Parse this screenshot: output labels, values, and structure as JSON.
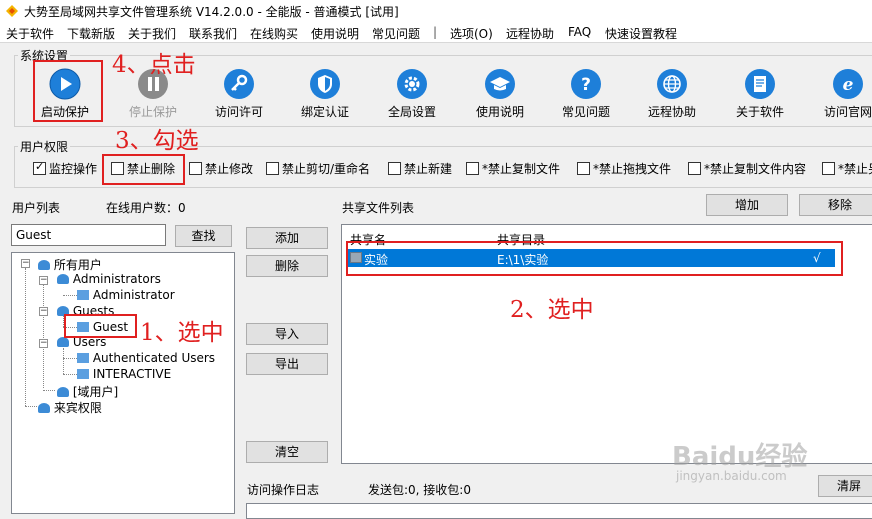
{
  "window": {
    "title": "大势至局域网共享文件管理系统 V14.2.0.0 - 全能版 - 普通模式 [试用]"
  },
  "menu": [
    "关于软件",
    "下载新版",
    "关于我们",
    "联系我们",
    "在线购买",
    "使用说明",
    "常见问题",
    "|",
    "选项(O)",
    "远程协助",
    "FAQ",
    "快速设置教程"
  ],
  "system_settings": {
    "group_label": "系统设置",
    "buttons": [
      {
        "label": "启动保护",
        "icon": "play-icon",
        "color": "#1e7fd9"
      },
      {
        "label": "停止保护",
        "icon": "pause-icon",
        "color": "#8a8a8a"
      },
      {
        "label": "访问许可",
        "icon": "key-icon",
        "color": "#1e7fd9"
      },
      {
        "label": "绑定认证",
        "icon": "shield-icon",
        "color": "#1e7fd9"
      },
      {
        "label": "全局设置",
        "icon": "gear-icon",
        "color": "#1e7fd9"
      },
      {
        "label": "使用说明",
        "icon": "graduation-cap-icon",
        "color": "#1e7fd9"
      },
      {
        "label": "常见问题",
        "icon": "question-icon",
        "color": "#1e7fd9"
      },
      {
        "label": "远程协助",
        "icon": "globe-icon",
        "color": "#1e7fd9"
      },
      {
        "label": "关于软件",
        "icon": "document-icon",
        "color": "#1e7fd9"
      },
      {
        "label": "访问官网",
        "icon": "ie-icon",
        "color": "#1e7fd9"
      }
    ]
  },
  "user_permissions": {
    "group_label": "用户权限",
    "checkboxes": [
      {
        "label": "监控操作",
        "checked": true
      },
      {
        "label": "禁止删除",
        "checked": false
      },
      {
        "label": "禁止修改",
        "checked": false
      },
      {
        "label": "禁止剪切/重命名",
        "checked": false
      },
      {
        "label": "禁止新建",
        "checked": false
      },
      {
        "label": "*禁止复制文件",
        "checked": false
      },
      {
        "label": "*禁止拖拽文件",
        "checked": false
      },
      {
        "label": "*禁止复制文件内容",
        "checked": false
      },
      {
        "label": "*禁止另",
        "checked": false
      }
    ]
  },
  "users": {
    "list_label": "用户列表",
    "online_label": "在线用户数：0",
    "search_value": "Guest",
    "find_button": "查找",
    "tree": {
      "root": "所有用户",
      "administrators": "Administrators",
      "administrator": "Administrator",
      "guests": "Guests",
      "guest": "Guest",
      "users_group": "Users",
      "authenticated": "Authenticated Users",
      "interactive": "INTERACTIVE",
      "domain": "[域用户]",
      "visitors": "来宾权限"
    }
  },
  "middle_buttons": {
    "add": "添加",
    "delete": "删除",
    "import": "导入",
    "export": "导出",
    "clear": "清空"
  },
  "shares": {
    "list_label": "共享文件列表",
    "add_button": "增加",
    "remove_button": "移除",
    "columns": [
      "共享名",
      "共享目录"
    ],
    "rows": [
      {
        "name": "实验",
        "path": "E:\\1\\实验",
        "check": "√"
      }
    ]
  },
  "log": {
    "label": "访问操作日志",
    "stats": "发送包:0, 接收包:0",
    "clear_button": "清屏"
  },
  "annotations": [
    "4、点击",
    "3、勾选",
    "1、选中",
    "2、选中"
  ],
  "watermark": {
    "brand": "Baidu经验",
    "url": "jingyan.baidu.com"
  },
  "colors": {
    "selection": "#0078d7",
    "annotation": "#e02020",
    "icon_blue": "#1e7fd9"
  }
}
